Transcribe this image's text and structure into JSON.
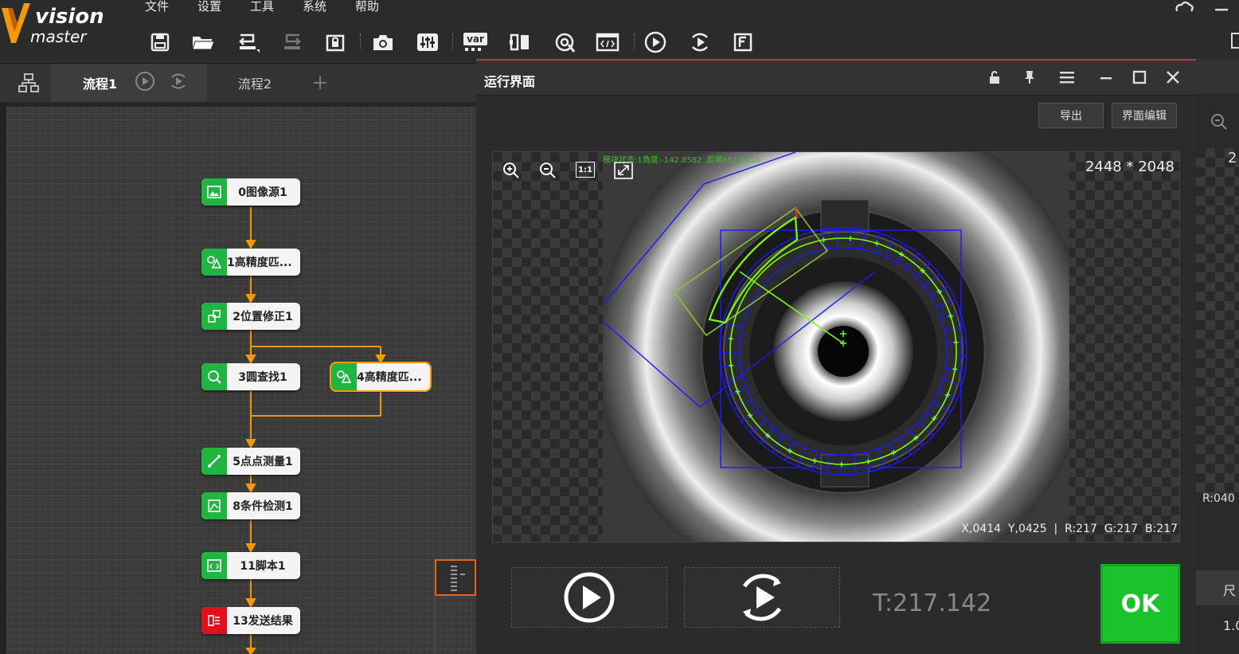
{
  "menu": [
    "文件",
    "设置",
    "工具",
    "系统",
    "帮助"
  ],
  "logo": {
    "line1": "vision",
    "line2": "master"
  },
  "flow_tabs": {
    "tab1": "流程1",
    "tab2": "流程2",
    "add": "+"
  },
  "nodes": [
    {
      "id": "n0",
      "label": "0图像源1",
      "color": "#1fb540"
    },
    {
      "id": "n1",
      "label": "1高精度匹...",
      "color": "#1fb540"
    },
    {
      "id": "n2",
      "label": "2位置修正1",
      "color": "#1fb540"
    },
    {
      "id": "n3",
      "label": "3圆查找1",
      "color": "#1fb540"
    },
    {
      "id": "n4",
      "label": "4高精度匹...",
      "color": "#1fb540"
    },
    {
      "id": "n5",
      "label": "5点点测量1",
      "color": "#1fb540"
    },
    {
      "id": "n8",
      "label": "8条件检测1",
      "color": "#1fb540"
    },
    {
      "id": "n11",
      "label": "11脚本1",
      "color": "#1fb540"
    },
    {
      "id": "n13",
      "label": "13发送结果",
      "color": "#e0111a"
    }
  ],
  "run_window": {
    "title": "运行界面",
    "export": "导出",
    "edit_ui": "界面编辑",
    "resolution": "2448 * 2048",
    "status_text": "模块状态:1角度:-142.8582 ,距离651.8016",
    "zoom_1to1": "1:1",
    "pixel_info": "X,0414  Y,0425  |  R:217  G:217  B:217",
    "time": "T:217.142",
    "ok": "OK"
  },
  "right_pane": {
    "label_r": "R:040",
    "label_2": "2",
    "label_size": "尺",
    "label_val": "1.0"
  },
  "colors": {
    "accent_orange": "#f29a00",
    "green": "#1fb540",
    "ok_green": "#19c32a",
    "overlay_green": "#7cfc00",
    "overlay_blue": "#1a1aff"
  }
}
